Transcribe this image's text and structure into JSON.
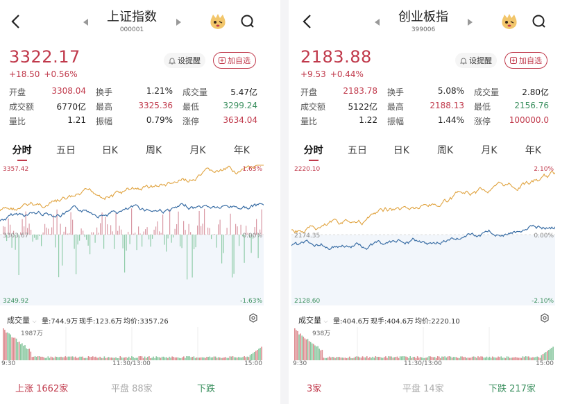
{
  "colors": {
    "up": "#c0394b",
    "down": "#3a8f5e",
    "price_line": "#3a6ea5",
    "avg_line": "#e0a33f"
  },
  "panels": [
    {
      "header": {
        "title": "上证指数",
        "code": "000001",
        "back_icon": "chevron-left-icon",
        "prev_icon": "triangle-left-icon",
        "next_icon": "triangle-right-icon",
        "mascot_icon": "mascot-icon",
        "search_icon": "search-icon"
      },
      "quote": {
        "price": "3322.17",
        "change": "+18.50",
        "change_pct": "+0.56%"
      },
      "actions": {
        "alert": "设提醒",
        "watchlist": "加自选"
      },
      "stats": [
        [
          {
            "label": "开盘",
            "value": "3308.04",
            "tone": "up"
          },
          {
            "label": "换手",
            "value": "1.21%",
            "tone": ""
          },
          {
            "label": "成交量",
            "value": "5.47亿",
            "tone": ""
          }
        ],
        [
          {
            "label": "成交额",
            "value": "6770亿",
            "tone": ""
          },
          {
            "label": "最高",
            "value": "3325.36",
            "tone": "up"
          },
          {
            "label": "最低",
            "value": "3299.24",
            "tone": "down"
          }
        ],
        [
          {
            "label": "量比",
            "value": "1.21",
            "tone": ""
          },
          {
            "label": "振幅",
            "value": "0.79%",
            "tone": ""
          },
          {
            "label": "涨停",
            "value": "3634.04",
            "tone": "up"
          }
        ]
      ],
      "tabs": [
        "分时",
        "五日",
        "日K",
        "周K",
        "月K",
        "年K"
      ],
      "active_tab": 0,
      "chart": {
        "y_max": "3357.42",
        "y_mid": "3303.67",
        "y_min": "3249.92",
        "pct_max": "1.63%",
        "pct_mid": "0.00%",
        "pct_min": "-1.63%"
      },
      "volume": {
        "selector": "成交量",
        "total": "量:744.9万",
        "last": "现手:123.6万",
        "avg": "均价:3357.26",
        "peak": "1987万"
      },
      "time_axis": [
        "9:30",
        "11:30/13:00",
        "15:00"
      ],
      "breadth": {
        "up": "上涨 1662家",
        "flat": "平盘 88家",
        "down": "下跌"
      }
    },
    {
      "header": {
        "title": "创业板指",
        "code": "399006",
        "back_icon": "chevron-left-icon",
        "prev_icon": "triangle-left-icon",
        "next_icon": "triangle-right-icon",
        "mascot_icon": "mascot-icon",
        "search_icon": "search-icon"
      },
      "quote": {
        "price": "2183.88",
        "change": "+9.53",
        "change_pct": "+0.44%"
      },
      "actions": {
        "alert": "设提醒",
        "watchlist": "加自选"
      },
      "stats": [
        [
          {
            "label": "开盘",
            "value": "2183.78",
            "tone": "up"
          },
          {
            "label": "换手",
            "value": "5.08%",
            "tone": ""
          },
          {
            "label": "成交量",
            "value": "2.80亿",
            "tone": ""
          }
        ],
        [
          {
            "label": "成交额",
            "value": "5122亿",
            "tone": ""
          },
          {
            "label": "最高",
            "value": "2188.13",
            "tone": "up"
          },
          {
            "label": "最低",
            "value": "2156.76",
            "tone": "down"
          }
        ],
        [
          {
            "label": "量比",
            "value": "1.22",
            "tone": ""
          },
          {
            "label": "振幅",
            "value": "1.44%",
            "tone": ""
          },
          {
            "label": "涨停",
            "value": "100000.0",
            "tone": "up"
          }
        ]
      ],
      "tabs": [
        "分时",
        "五日",
        "日K",
        "周K",
        "月K",
        "年K"
      ],
      "active_tab": 0,
      "chart": {
        "y_max": "2220.10",
        "y_mid": "2174.35",
        "y_min": "2128.60",
        "pct_max": "2.10%",
        "pct_mid": "0.00%",
        "pct_min": "-2.10%"
      },
      "volume": {
        "selector": "成交量",
        "total": "量:404.6万",
        "last": "现手:404.6万",
        "avg": "均价:2220.10",
        "peak": "938万"
      },
      "time_axis": [
        "9:30",
        "11:30/13:00",
        "15:00"
      ],
      "breadth": {
        "up": "3家",
        "flat": "平盘 14家",
        "down": "下跌 217家"
      }
    }
  ]
}
